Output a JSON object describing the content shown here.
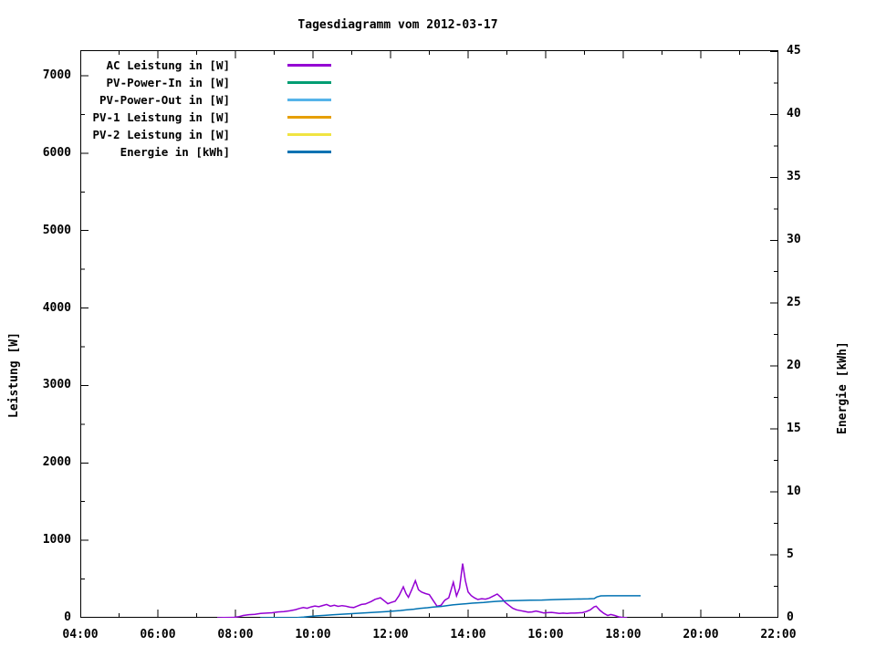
{
  "chart_data": {
    "type": "line",
    "title": "Tagesdiagramm vom 2012-03-17",
    "xlabel": "",
    "ylabel": "Leistung [W]",
    "y2label": "Energie [kWh]",
    "x_range_hours": [
      4,
      22
    ],
    "x_major_tick_hours": [
      4,
      6,
      8,
      10,
      12,
      14,
      16,
      18,
      20,
      22
    ],
    "x_major_tick_labels": [
      "04:00",
      "06:00",
      "08:00",
      "10:00",
      "12:00",
      "14:00",
      "16:00",
      "18:00",
      "20:00",
      "22:00"
    ],
    "x_minor_interval_hours": 1,
    "y_range": [
      0,
      7330
    ],
    "y_major_ticks": [
      0,
      1000,
      2000,
      3000,
      4000,
      5000,
      6000,
      7000
    ],
    "y_minor_interval": 500,
    "y2_range": [
      0,
      45.1
    ],
    "y2_major_ticks": [
      0,
      5,
      10,
      15,
      20,
      25,
      30,
      35,
      40,
      45
    ],
    "y2_minor_interval": 2.5,
    "grid": false,
    "legend_position": "top-left-inside",
    "series": [
      {
        "name": "AC Leistung in [W]",
        "color": "#9400d3",
        "axis": "y",
        "points": [
          [
            7.53,
            0
          ],
          [
            7.7,
            3
          ],
          [
            7.95,
            5
          ],
          [
            8.1,
            15
          ],
          [
            8.2,
            30
          ],
          [
            8.35,
            40
          ],
          [
            8.5,
            45
          ],
          [
            8.65,
            55
          ],
          [
            8.8,
            60
          ],
          [
            8.95,
            65
          ],
          [
            9.1,
            75
          ],
          [
            9.25,
            80
          ],
          [
            9.4,
            90
          ],
          [
            9.55,
            105
          ],
          [
            9.65,
            120
          ],
          [
            9.75,
            132
          ],
          [
            9.85,
            122
          ],
          [
            9.95,
            140
          ],
          [
            10.05,
            152
          ],
          [
            10.15,
            143
          ],
          [
            10.25,
            158
          ],
          [
            10.35,
            172
          ],
          [
            10.45,
            150
          ],
          [
            10.55,
            162
          ],
          [
            10.65,
            147
          ],
          [
            10.75,
            157
          ],
          [
            10.85,
            150
          ],
          [
            10.95,
            137
          ],
          [
            11.05,
            132
          ],
          [
            11.15,
            152
          ],
          [
            11.25,
            172
          ],
          [
            11.35,
            178
          ],
          [
            11.5,
            210
          ],
          [
            11.6,
            238
          ],
          [
            11.74,
            258
          ],
          [
            11.85,
            215
          ],
          [
            11.93,
            182
          ],
          [
            12.02,
            198
          ],
          [
            12.12,
            213
          ],
          [
            12.22,
            288
          ],
          [
            12.33,
            400
          ],
          [
            12.4,
            312
          ],
          [
            12.46,
            265
          ],
          [
            12.55,
            368
          ],
          [
            12.64,
            478
          ],
          [
            12.72,
            362
          ],
          [
            12.8,
            332
          ],
          [
            12.9,
            312
          ],
          [
            13.0,
            298
          ],
          [
            13.1,
            222
          ],
          [
            13.2,
            148
          ],
          [
            13.3,
            162
          ],
          [
            13.4,
            228
          ],
          [
            13.5,
            258
          ],
          [
            13.62,
            458
          ],
          [
            13.7,
            282
          ],
          [
            13.78,
            382
          ],
          [
            13.86,
            700
          ],
          [
            13.93,
            478
          ],
          [
            14.0,
            332
          ],
          [
            14.08,
            286
          ],
          [
            14.16,
            258
          ],
          [
            14.25,
            236
          ],
          [
            14.35,
            246
          ],
          [
            14.45,
            240
          ],
          [
            14.55,
            256
          ],
          [
            14.65,
            280
          ],
          [
            14.75,
            306
          ],
          [
            14.85,
            262
          ],
          [
            14.95,
            202
          ],
          [
            15.05,
            162
          ],
          [
            15.15,
            122
          ],
          [
            15.25,
            102
          ],
          [
            15.35,
            92
          ],
          [
            15.45,
            82
          ],
          [
            15.55,
            72
          ],
          [
            15.65,
            76
          ],
          [
            15.75,
            86
          ],
          [
            15.85,
            76
          ],
          [
            15.95,
            62
          ],
          [
            16.05,
            66
          ],
          [
            16.15,
            70
          ],
          [
            16.25,
            64
          ],
          [
            16.35,
            56
          ],
          [
            16.45,
            60
          ],
          [
            16.55,
            56
          ],
          [
            16.65,
            60
          ],
          [
            16.75,
            60
          ],
          [
            16.85,
            64
          ],
          [
            16.95,
            66
          ],
          [
            17.05,
            80
          ],
          [
            17.15,
            102
          ],
          [
            17.25,
            142
          ],
          [
            17.3,
            150
          ],
          [
            17.4,
            96
          ],
          [
            17.5,
            56
          ],
          [
            17.6,
            30
          ],
          [
            17.68,
            42
          ],
          [
            17.78,
            30
          ],
          [
            17.88,
            12
          ],
          [
            18.0,
            4
          ],
          [
            18.1,
            0
          ]
        ]
      },
      {
        "name": "PV-Power-In in [W]",
        "color": "#009e73",
        "axis": "y",
        "points": []
      },
      {
        "name": "PV-Power-Out in [W]",
        "color": "#56b4e9",
        "axis": "y",
        "points": []
      },
      {
        "name": "PV-1 Leistung in [W]",
        "color": "#e69f00",
        "axis": "y",
        "points": []
      },
      {
        "name": "PV-2 Leistung in [W]",
        "color": "#f0e442",
        "axis": "y",
        "points": []
      },
      {
        "name": "Energie in [kWh]",
        "color": "#0072b2",
        "axis": "y2",
        "points": [
          [
            8.64,
            0
          ],
          [
            9.6,
            0.02
          ],
          [
            9.76,
            0.05
          ],
          [
            9.9,
            0.1
          ],
          [
            10.1,
            0.15
          ],
          [
            10.3,
            0.19
          ],
          [
            10.5,
            0.23
          ],
          [
            10.7,
            0.27
          ],
          [
            10.9,
            0.31
          ],
          [
            11.1,
            0.34
          ],
          [
            11.3,
            0.38
          ],
          [
            11.5,
            0.42
          ],
          [
            11.7,
            0.46
          ],
          [
            11.9,
            0.49
          ],
          [
            12.05,
            0.52
          ],
          [
            12.25,
            0.57
          ],
          [
            12.4,
            0.62
          ],
          [
            12.6,
            0.68
          ],
          [
            12.75,
            0.75
          ],
          [
            12.95,
            0.8
          ],
          [
            13.1,
            0.85
          ],
          [
            13.3,
            0.9
          ],
          [
            13.45,
            0.96
          ],
          [
            13.6,
            1.02
          ],
          [
            13.8,
            1.08
          ],
          [
            13.95,
            1.12
          ],
          [
            14.1,
            1.16
          ],
          [
            14.25,
            1.19
          ],
          [
            14.4,
            1.22
          ],
          [
            14.55,
            1.26
          ],
          [
            14.7,
            1.3
          ],
          [
            14.85,
            1.33
          ],
          [
            15.0,
            1.35
          ],
          [
            15.3,
            1.37
          ],
          [
            15.6,
            1.39
          ],
          [
            15.9,
            1.41
          ],
          [
            16.2,
            1.44
          ],
          [
            16.5,
            1.47
          ],
          [
            16.8,
            1.49
          ],
          [
            17.1,
            1.5
          ],
          [
            17.25,
            1.52
          ],
          [
            17.32,
            1.65
          ],
          [
            17.42,
            1.74
          ],
          [
            17.6,
            1.75
          ],
          [
            18.45,
            1.75
          ]
        ]
      }
    ]
  }
}
